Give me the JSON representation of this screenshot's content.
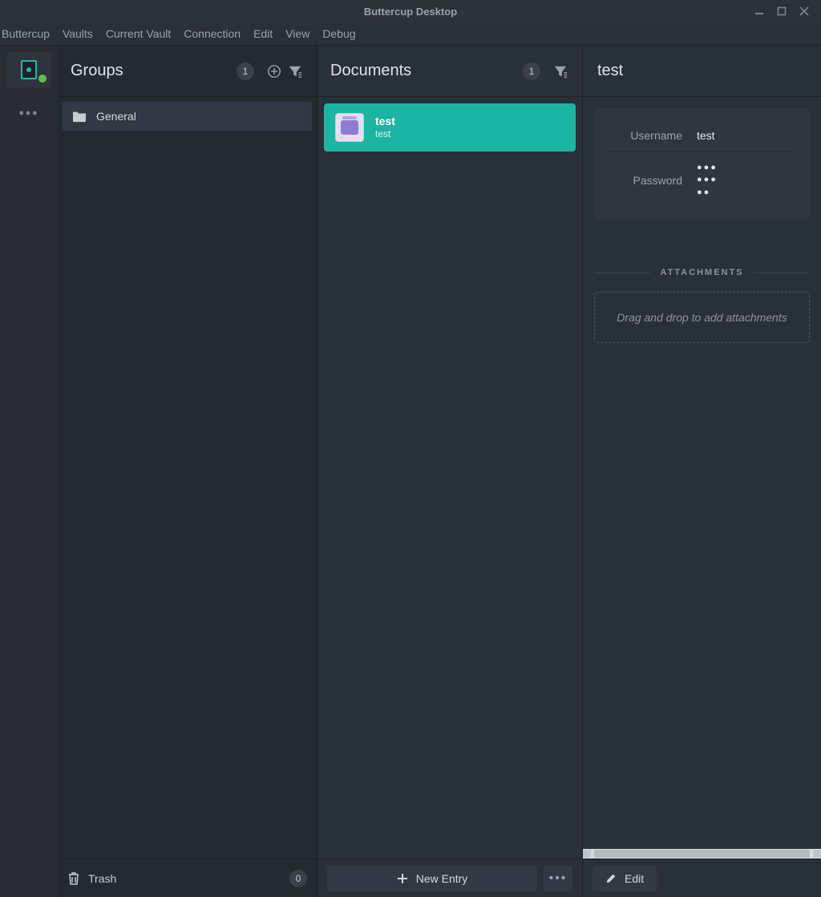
{
  "window": {
    "title": "Buttercup Desktop"
  },
  "menubar": {
    "items": [
      "Buttercup",
      "Vaults",
      "Current Vault",
      "Connection",
      "Edit",
      "View",
      "Debug"
    ]
  },
  "groups": {
    "title": "Groups",
    "count": "1",
    "items": [
      {
        "label": "General"
      }
    ],
    "trash_label": "Trash",
    "trash_count": "0"
  },
  "documents": {
    "title": "Documents",
    "count": "1",
    "entries": [
      {
        "title": "test",
        "subtitle": "test"
      }
    ],
    "new_entry_label": "New Entry"
  },
  "detail": {
    "title": "test",
    "fields": {
      "username_label": "Username",
      "username_value": "test",
      "password_label": "Password",
      "password_mask": "●●●\n●●●\n●●"
    },
    "attachments_label": "ATTACHMENTS",
    "dropzone_text": "Drag and drop to add attachments",
    "edit_label": "Edit"
  }
}
